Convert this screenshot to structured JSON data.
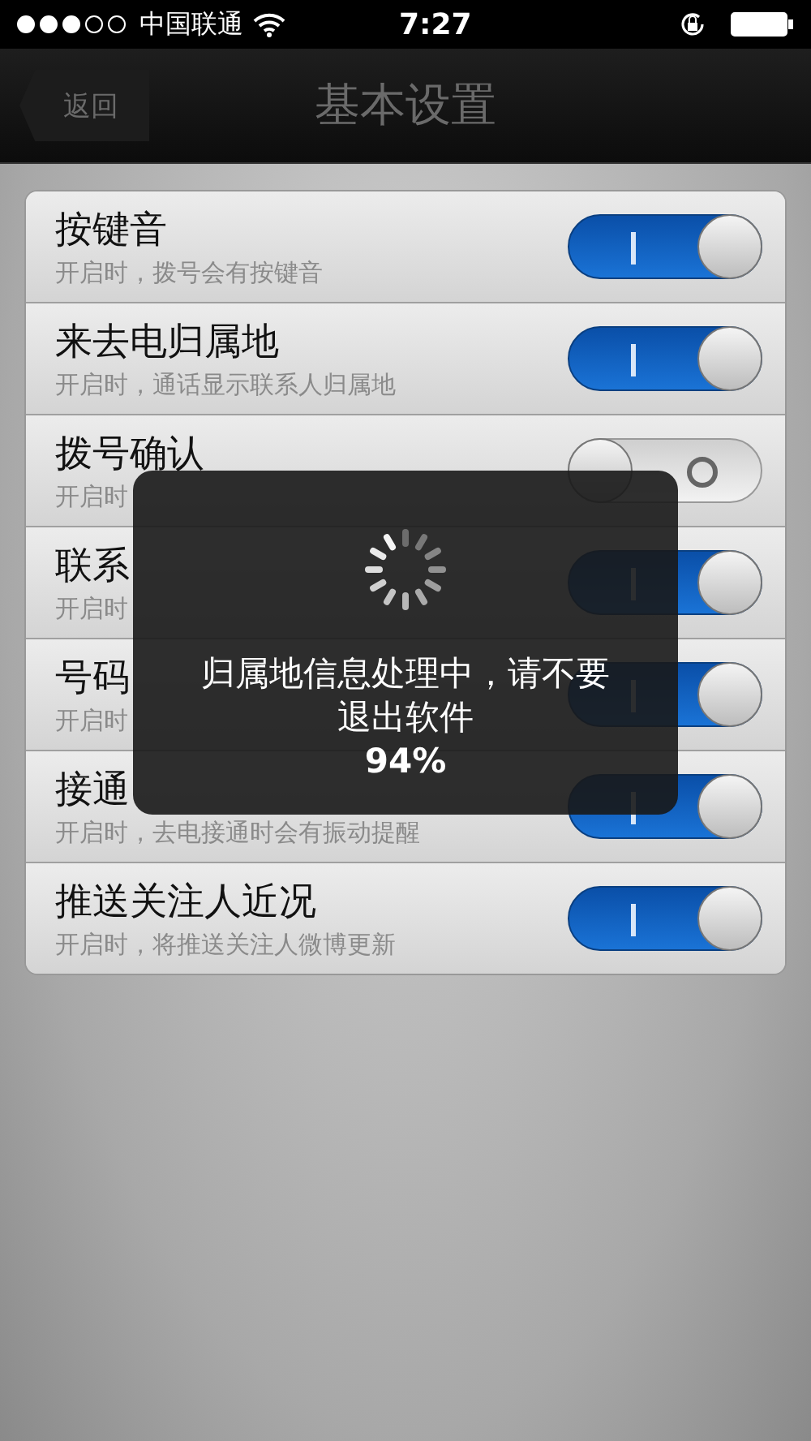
{
  "status_bar": {
    "carrier": "中国联通",
    "time": "7:27"
  },
  "nav": {
    "back": "返回",
    "title": "基本设置"
  },
  "settings": [
    {
      "title": "按键音",
      "subtitle": "开启时，拨号会有按键音",
      "on": true
    },
    {
      "title": "来去电归属地",
      "subtitle": "开启时，通话显示联系人归属地",
      "on": true
    },
    {
      "title": "拨号确认",
      "subtitle": "开启时",
      "on": false
    },
    {
      "title": "联系",
      "subtitle": "开启时",
      "on": true
    },
    {
      "title": "号码",
      "subtitle": "开启时",
      "on": true
    },
    {
      "title": "接通",
      "subtitle": "开启时，去电接通时会有振动提醒",
      "on": true
    },
    {
      "title": "推送关注人近况",
      "subtitle": "开启时，将推送关注人微博更新",
      "on": true
    }
  ],
  "progress_dialog": {
    "message": "归属地信息处理中，请不要退出软件",
    "percent": "94%"
  }
}
